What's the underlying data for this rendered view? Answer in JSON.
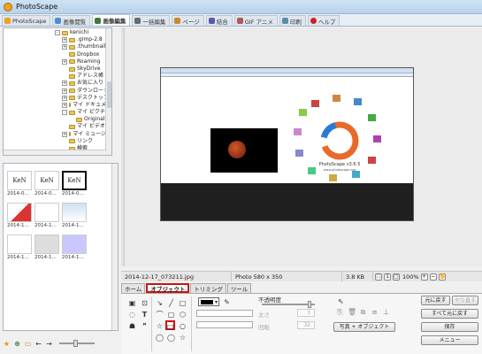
{
  "app": {
    "title": "PhotoScape"
  },
  "tabs": [
    {
      "label": "PhotoScape",
      "color": "#f0a020"
    },
    {
      "label": "画像閲覧",
      "color": "#4a8fd6"
    },
    {
      "label": "画像編集",
      "color": "#3c7a3c"
    },
    {
      "label": "一括編集",
      "color": "#6a6a6a"
    },
    {
      "label": "ページ",
      "color": "#c98a2a"
    },
    {
      "label": "結合",
      "color": "#5a5aaa"
    },
    {
      "label": "GIF アニメ",
      "color": "#aa5a5a"
    },
    {
      "label": "印刷",
      "color": "#5a8aaa"
    },
    {
      "label": "ヘルプ",
      "color": "#cc2222"
    }
  ],
  "tree": [
    {
      "label": "kenichi",
      "indent": 0,
      "exp": "-"
    },
    {
      "label": ".gimp-2.8",
      "indent": 1,
      "exp": "+"
    },
    {
      "label": ".thumbnails",
      "indent": 1,
      "exp": "+"
    },
    {
      "label": "Dropbox",
      "indent": 1,
      "exp": ""
    },
    {
      "label": "Roaming",
      "indent": 1,
      "exp": "+"
    },
    {
      "label": "SkyDrive",
      "indent": 1,
      "exp": ""
    },
    {
      "label": "アドレス帳",
      "indent": 1,
      "exp": ""
    },
    {
      "label": "お気に入り",
      "indent": 1,
      "exp": "+"
    },
    {
      "label": "ダウンロード",
      "indent": 1,
      "exp": "+"
    },
    {
      "label": "デスクトップ",
      "indent": 1,
      "exp": "+"
    },
    {
      "label": "マイ ドキュメン",
      "indent": 1,
      "exp": "+"
    },
    {
      "label": "マイ ピクチャ",
      "indent": 1,
      "exp": "-"
    },
    {
      "label": "Originals",
      "indent": 2,
      "exp": ""
    },
    {
      "label": "マイ ビデオ",
      "indent": 1,
      "exp": ""
    },
    {
      "label": "マイ ミュージッ",
      "indent": 1,
      "exp": "+"
    },
    {
      "label": "リンク",
      "indent": 1,
      "exp": ""
    },
    {
      "label": "検索",
      "indent": 1,
      "exp": ""
    }
  ],
  "thumbnails": [
    {
      "label": "2014-0...",
      "text": "KeN"
    },
    {
      "label": "2014-0...",
      "text": "KeN"
    },
    {
      "label": "2014-0...",
      "text": "KeN"
    },
    {
      "label": "2014-1...",
      "text": ""
    },
    {
      "label": "2014-1...",
      "text": ""
    },
    {
      "label": "2014-1...",
      "text": ""
    },
    {
      "label": "2014-1...",
      "text": ""
    },
    {
      "label": "2014-1...",
      "text": ""
    },
    {
      "label": "2014-1...",
      "text": ""
    }
  ],
  "status": {
    "filename": "2014-12-17_073211.jpg",
    "photo_size": "Photo 580 x 350",
    "file_size": "3.8 KB",
    "zoom": "100%"
  },
  "edit_tabs": [
    "ホーム",
    "オブジェクト",
    "トリミング",
    "ツール"
  ],
  "edit": {
    "opacity_label": "不透明度",
    "thickness_label": "太さ",
    "rotate_label": "回転",
    "thickness_value": "3",
    "rotate_value": "32",
    "photo_object_button": "写真 + オブジェクト",
    "undo_button": "元に戻す",
    "redo_button": "やり直す",
    "undo_all_button": "すべて元に戻す",
    "save_button": "保存",
    "menu_button": "メニュー"
  },
  "preview": {
    "inner_caption": "PhotoScape v3.6.5",
    "inner_url": "www.photoscape.org"
  }
}
